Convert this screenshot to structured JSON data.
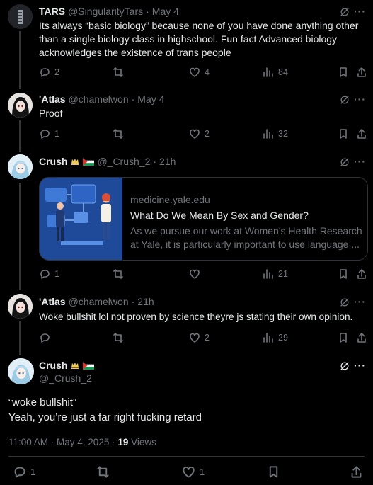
{
  "tweets": [
    {
      "name": "TARS",
      "handle": "@SingularityTars",
      "sep": "·",
      "time": "May 4",
      "text": "Its always “basic biology” because none of you have done anything other than a single biology class in highschool. Fun fact Advanced biology acknowledges the existence of trans people",
      "replies": "2",
      "retweets": "",
      "likes": "4",
      "views": "84"
    },
    {
      "name": "'Atlas",
      "handle": "@chamelwon",
      "sep": "·",
      "time": "May 4",
      "text": "Proof",
      "replies": "1",
      "retweets": "",
      "likes": "2",
      "views": "32"
    },
    {
      "name": "Crush",
      "handle": "@_Crush_2",
      "sep": "·",
      "time": "21h",
      "text": "",
      "replies": "1",
      "retweets": "",
      "likes": "",
      "views": "21",
      "card": {
        "domain": "medicine.yale.edu",
        "title": "What Do We Mean By Sex and Gender?",
        "desc": "As we pursue our work at Women's Health Research at Yale, it is particularly important to use language ..."
      }
    },
    {
      "name": "'Atlas",
      "handle": "@chamelwon",
      "sep": "·",
      "time": "21h",
      "text": "Woke bullshit lol not proven by science theyre js stating their own opinion.",
      "replies": "",
      "retweets": "",
      "likes": "2",
      "views": "29"
    }
  ],
  "main": {
    "name": "Crush",
    "handle": "@_Crush_2",
    "line1": "“woke bullshit”",
    "line2": "Yeah, you’re just a far right fucking retard",
    "timestamp": "11:00 AM · May 4, 2025 · ",
    "views_count": "19",
    "views_label": " Views",
    "replies": "1",
    "likes": "1"
  },
  "more_icon": "···",
  "colors": {
    "bg": "#000000",
    "text": "#e7e9ea",
    "muted": "#71767b",
    "border": "#2f3336"
  }
}
